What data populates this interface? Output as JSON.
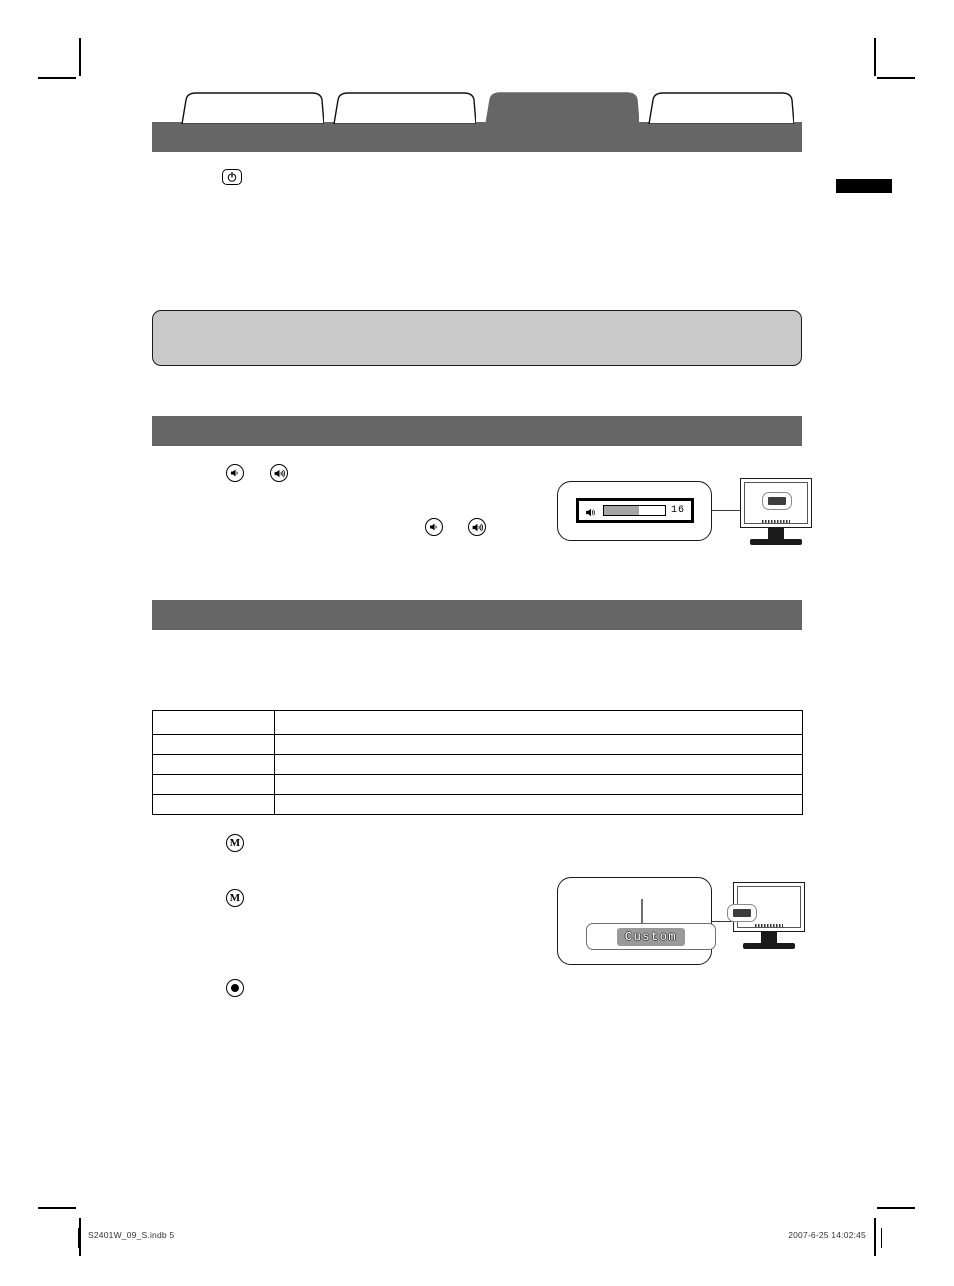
{
  "page": {
    "number": "5",
    "side_marker_color": "#000000",
    "accent_gray": "#666666",
    "note_gray": "#c9c9c9"
  },
  "tabs": [
    {
      "label": "",
      "name": "tab-1",
      "active": false
    },
    {
      "label": "",
      "name": "tab-2",
      "active": false
    },
    {
      "label": "",
      "name": "tab-3",
      "active": true
    },
    {
      "label": "",
      "name": "tab-4",
      "active": false
    }
  ],
  "top_section": {
    "power_icon": "power-button-icon",
    "body_text": ""
  },
  "note_box": {
    "text": ""
  },
  "sections": [
    {
      "name": "volume-section",
      "heading": "",
      "body_text": "",
      "icons": [
        "volume-down-icon",
        "volume-up-icon"
      ],
      "secondary_icons": [
        "volume-down-icon",
        "volume-up-icon"
      ]
    },
    {
      "name": "mode-section",
      "heading": "",
      "body_text": ""
    }
  ],
  "table": {
    "columns": [
      "",
      ""
    ],
    "rows": [
      [
        "",
        ""
      ],
      [
        "",
        ""
      ],
      [
        "",
        ""
      ],
      [
        "",
        ""
      ],
      [
        "",
        ""
      ]
    ]
  },
  "steps": [
    {
      "icon": "mode-button-icon",
      "label": ""
    },
    {
      "icon": "mode-button-icon",
      "label": ""
    },
    {
      "icon": "enter-button-icon",
      "label": ""
    }
  ],
  "illustrations": {
    "volume_osd": {
      "name": "volume-osd-illustration",
      "speaker_icon": "speaker-icon",
      "value": "16",
      "fill_percent": 57,
      "bar_fill_color": "#a6a6a6",
      "monitor": "monitor-illustration"
    },
    "mode_osd": {
      "name": "mode-osd-illustration",
      "value": "Custom",
      "badge_color": "#9a9a9a",
      "monitor": "monitor-illustration"
    }
  },
  "footer": {
    "file": "S2401W_09_S.indb   5",
    "timestamp": "2007-6-25   14:02:45"
  }
}
